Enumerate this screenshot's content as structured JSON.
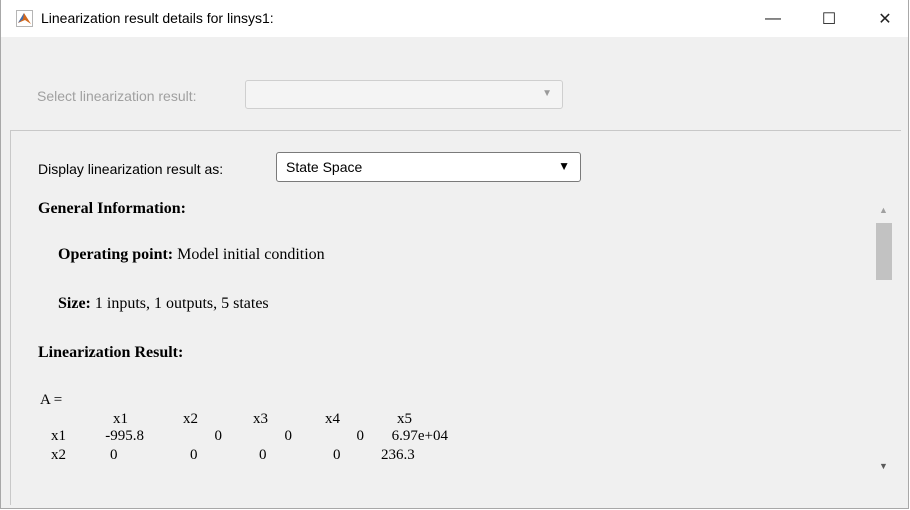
{
  "window": {
    "title": "Linearization result details for linsys1:",
    "minimize_glyph": "—",
    "maximize_glyph": "☐",
    "close_glyph": "✕"
  },
  "select_result": {
    "label": "Select linearization result:",
    "value": "",
    "arrow": "▼"
  },
  "display_as": {
    "label": "Display linearization result as:",
    "value": "State Space",
    "arrow": "▼"
  },
  "content": {
    "general_heading": "General Information:",
    "operating_point_label": "Operating point:",
    "operating_point_value": "Model initial condition",
    "size_label": "Size:",
    "size_value": "1 inputs, 1 outputs, 5 states",
    "result_heading": "Linearization Result:",
    "matrix_name": "A =",
    "col_headers": [
      "x1",
      "x2",
      "x3",
      "x4",
      "x5"
    ],
    "rows": [
      {
        "label": "x1",
        "values": [
          "-995.8",
          "0",
          "0",
          "0",
          "6.97e+04"
        ]
      },
      {
        "label": "x2",
        "values": [
          "0",
          "0",
          "0",
          "0",
          "236.3"
        ]
      }
    ]
  },
  "scrollbar": {
    "up_arrow": "▲",
    "down_arrow": "▼"
  }
}
